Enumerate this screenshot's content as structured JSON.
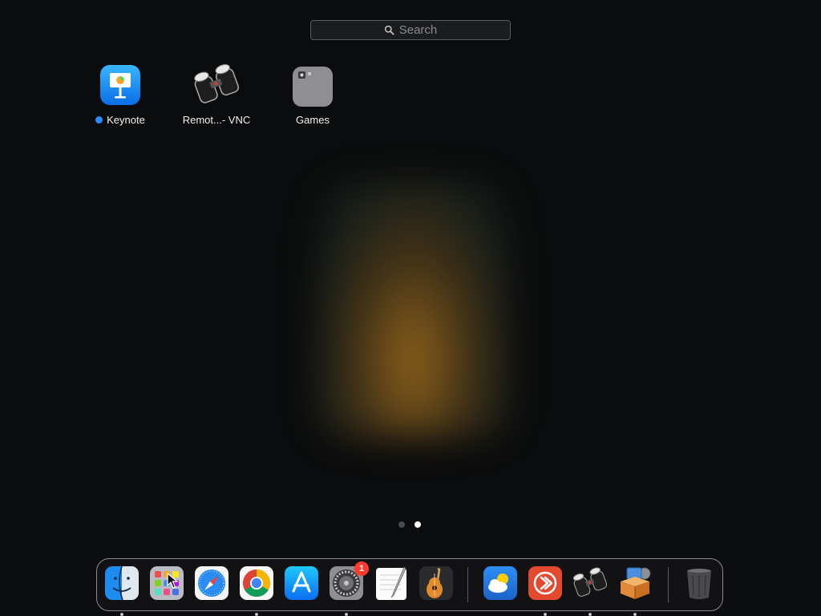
{
  "search": {
    "placeholder": "Search"
  },
  "apps": [
    {
      "label": "Keynote",
      "new": true,
      "icon": "keynote-icon"
    },
    {
      "label": "Remot...- VNC",
      "icon": "remote-vnc-icon"
    },
    {
      "label": "Games",
      "icon": "games-folder-icon"
    }
  ],
  "pages": {
    "count": 2,
    "current": 2
  },
  "dock": {
    "items": [
      {
        "name": "Finder",
        "icon": "finder-icon",
        "running": true
      },
      {
        "name": "Launchpad",
        "icon": "launchpad-icon",
        "running": false
      },
      {
        "name": "Safari",
        "icon": "safari-icon",
        "running": false
      },
      {
        "name": "Google Chrome",
        "icon": "chrome-icon",
        "running": true
      },
      {
        "name": "App Store",
        "icon": "app-store-icon",
        "running": false
      },
      {
        "name": "System Preferences",
        "icon": "system-preferences-icon",
        "running": true,
        "badge": "1"
      },
      {
        "name": "TextEdit",
        "icon": "textedit-icon",
        "running": false
      },
      {
        "name": "GarageBand",
        "icon": "garageband-icon",
        "running": false
      },
      {
        "name": "Weather",
        "icon": "weather-icon",
        "running": false
      },
      {
        "name": "Remote Desktop",
        "icon": "remote-desktop-icon",
        "running": true
      },
      {
        "name": "Remote VNC",
        "icon": "remote-vnc-icon",
        "running": true
      },
      {
        "name": "Installer",
        "icon": "installer-icon",
        "running": true
      },
      {
        "name": "Trash",
        "icon": "trash-icon",
        "running": false
      }
    ]
  },
  "colors": {
    "accent": "#2a8cff",
    "badge": "#ff3b30",
    "background": "#0b0c0d"
  }
}
